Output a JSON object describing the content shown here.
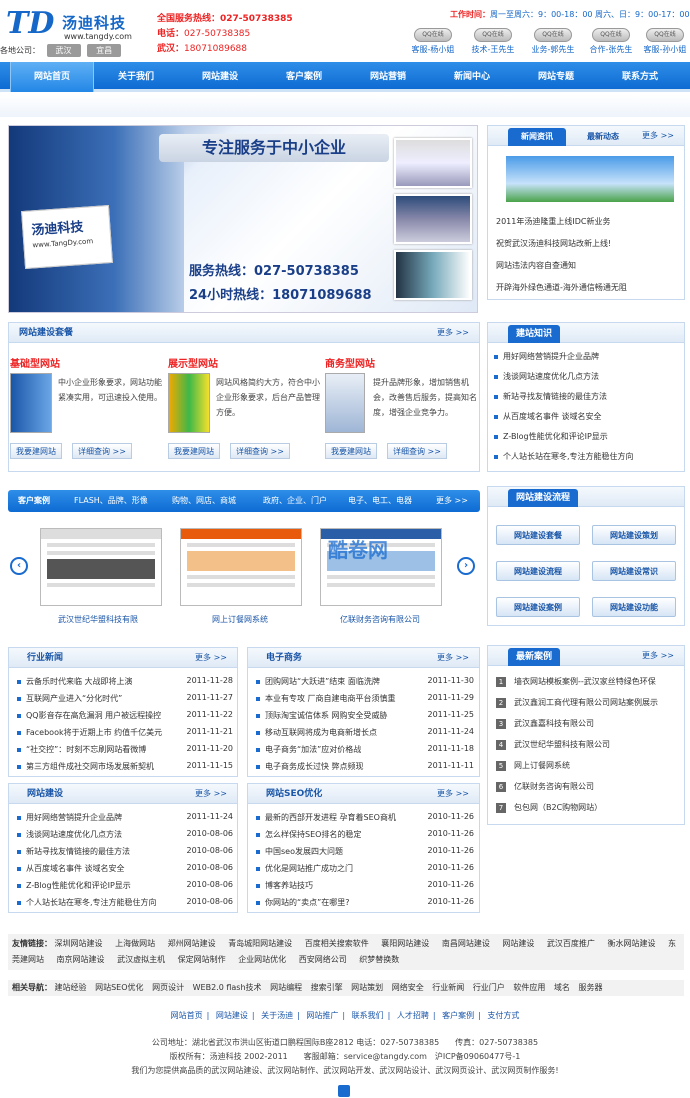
{
  "header": {
    "logo_mark": "TD",
    "logo_cn": "汤迪科技",
    "logo_url": "www.tangdy.com",
    "branch_label": "各地公司：",
    "branches": [
      "武汉",
      "宜昌"
    ],
    "hotline_label": "全国服务热线：",
    "hotline": "027-50738385",
    "phone_label": "电话：",
    "phone": "027-50738385",
    "wuhan_label": "武汉：",
    "wuhan": "18071089688",
    "worktime_label": "工作时间：",
    "worktime": "周一至周六：9：00-18：00 周六、日：9：00-17：00",
    "qq": [
      {
        "icon": "QQ在线",
        "name": "客服-杨小姐"
      },
      {
        "icon": "QQ在线",
        "name": "技术-王先生"
      },
      {
        "icon": "QQ在线",
        "name": "业务-郭先生"
      },
      {
        "icon": "QQ在线",
        "name": "合作-张先生"
      },
      {
        "icon": "QQ在线",
        "name": "客服-孙小姐"
      }
    ]
  },
  "nav": [
    "网站首页",
    "关于我们",
    "网站建设",
    "客户案例",
    "网站营销",
    "新闻中心",
    "网站专题",
    "联系方式"
  ],
  "banner": {
    "slogan": "专注服务于中小企业",
    "card_title": "汤迪科技",
    "card_url": "www.TangDy.com",
    "hot1": "服务热线：027-50738385",
    "hot2": "24小时热线：18071089688"
  },
  "news_box": {
    "tab1": "新闻资讯",
    "tab2": "最新动态",
    "more": "更多 >>",
    "items": [
      "2011年汤迪隆重上线IDC新业务",
      "祝贺武汉汤迪科技网站改新上线!",
      "网站违法内容自查通知",
      "开辟海外绿色通道-海外通信畅通无阻"
    ]
  },
  "plan_box": {
    "title": "网站建设套餐",
    "more": "更多 >>",
    "plans": [
      {
        "title": "基础型网站",
        "desc": "中小企业形象要求，网站功能紧凑实用，可迅速投入使用。",
        "btn1": "我要建网站",
        "btn2": "详细查询 >>"
      },
      {
        "title": "展示型网站",
        "desc": "网站风格简约大方，符合中小企业形象要求，后台产品管理方便。",
        "btn1": "我要建网站",
        "btn2": "详细查询 >>"
      },
      {
        "title": "商务型网站",
        "desc": "提升品牌形象，增加销售机会，改善售后服务，提高知名度，增强企业竞争力。",
        "btn1": "我要建网站",
        "btn2": "详细查询 >>"
      }
    ]
  },
  "knowledge": {
    "title": "建站知识",
    "items": [
      "用好网络营销提升企业品牌",
      "浅谈网站速度优化几点方法",
      "新站寻找友情链接的最佳方法",
      "从百度域名事件 谈域名安全",
      "Z-Blog性能优化和评论IP显示",
      "个人站长站在寒冬,专注方能稳住方向"
    ]
  },
  "cases": {
    "label": "客户案例",
    "cats": [
      "FLASH、品牌、形像",
      "购物、网店、商城",
      "政府、企业、门户",
      "电子、电工、电器"
    ],
    "more": "更多 >>",
    "prev": "‹",
    "next": "›",
    "items": [
      "武汉世纪华盟科技有限",
      "网上订餐网系统",
      "亿联财务咨询有限公司"
    ],
    "watermark": "酷卷网"
  },
  "process": {
    "title": "网站建设流程",
    "buttons": [
      "网站建设套餐",
      "网站建设策划",
      "网站建设流程",
      "网站建设常识",
      "网站建设案例",
      "网站建设功能"
    ]
  },
  "industry": {
    "title": "行业新闻",
    "more": "更多 >>",
    "items": [
      [
        "云备乐时代来临 大战即将上演",
        "2011-11-28"
      ],
      [
        "互联网产业进入“分化时代”",
        "2011-11-27"
      ],
      [
        "QQ影音存在高危漏洞 用户被远程操控",
        "2011-11-22"
      ],
      [
        "Facebook将于近期上市 约值千亿美元",
        "2011-11-21"
      ],
      [
        "“社交控”：时刻不忘刷网站看微博",
        "2011-11-20"
      ],
      [
        "第三方组件成社交网市场发展新契机",
        "2011-11-15"
      ]
    ]
  },
  "ecommerce": {
    "title": "电子商务",
    "more": "更多 >>",
    "items": [
      [
        "团购网站“大跃进”结束 面临洗牌",
        "2011-11-30"
      ],
      [
        "本业有专攻 厂商自建电商平台须慎重",
        "2011-11-29"
      ],
      [
        "顶际淘宝诚信体系 网购安全受威胁",
        "2011-11-25"
      ],
      [
        "移动互联网将成为电商新增长点",
        "2011-11-24"
      ],
      [
        "电子商务“加法”应对价格战",
        "2011-11-18"
      ],
      [
        "电子商务成长过快 弊点频现",
        "2011-11-11"
      ]
    ]
  },
  "latest": {
    "title": "最新案例",
    "more": "更多 >>",
    "items": [
      "墙衣网站模板案例--武汉家丝特绿色环保",
      "武汉鑫润工商代理有限公司网站案例展示",
      "武汉鑫嘉科技有限公司",
      "武汉世纪华盟科技有限公司",
      "网上订餐网系统",
      "亿联财务咨询有限公司",
      "包包网（B2C购物网站）"
    ]
  },
  "build": {
    "title": "网站建设",
    "more": "更多 >>",
    "items": [
      [
        "用好网络营销提升企业品牌",
        "2011-11-24"
      ],
      [
        "浅谈网站速度优化几点方法",
        "2010-08-06"
      ],
      [
        "新站寻找友情链接的最佳方法",
        "2010-08-06"
      ],
      [
        "从百度域名事件 谈域名安全",
        "2010-08-06"
      ],
      [
        "Z-Blog性能优化和评论IP显示",
        "2010-08-06"
      ],
      [
        "个人站长站在寒冬,专注方能稳住方向",
        "2010-08-06"
      ]
    ]
  },
  "seo": {
    "title": "网站SEO优化",
    "more": "更多 >>",
    "items": [
      [
        "最新的西部开发进程 孕育着SEO商机",
        "2010-11-26"
      ],
      [
        "怎么样保持SEO排名的稳定",
        "2010-11-26"
      ],
      [
        "中国seo发展四大问题",
        "2010-11-26"
      ],
      [
        "优化是网站推广成功之门",
        "2010-11-26"
      ],
      [
        "博客养站技巧",
        "2010-11-26"
      ],
      [
        "你网站的“卖点”在哪里?",
        "2010-11-26"
      ]
    ]
  },
  "friends": {
    "label": "友情链接：",
    "links": [
      "深圳网站建设",
      "上海做网站",
      "郑州网站建设",
      "青岛城阳网站建设",
      "百度相关搜索软件",
      "襄阳网站建设",
      "南昌网站建设",
      "网站建设",
      "武汉百度推广",
      "衡水网站建设",
      "东莞建网站",
      "南京网站建设",
      "武汉虚拟主机",
      "保定网站制作",
      "企业网站优化",
      "西安网络公司",
      "织梦替换数"
    ]
  },
  "related": {
    "label": "相关导航：",
    "links": [
      "建站经验",
      "网站SEO优化",
      "网页设计",
      "WEB2.0 flash技术",
      "网站编程",
      "搜索引擎",
      "网站策划",
      "网络安全",
      "行业新闻",
      "行业门户",
      "软件应用",
      "域名",
      "服务器"
    ]
  },
  "footnav": [
    "网站首页",
    "网站建设",
    "关于汤迪",
    "网站推广",
    "联系我们",
    "人才招聘",
    "客户案例",
    "支付方式"
  ],
  "footinfo": [
    "公司地址：湖北省武汉市洪山区街道口鹏程国际B座2812 电话：027-50738385　　传真：027-50738385",
    "版权所有：汤迪科技 2002-2011　　客服邮箱：service@tangdy.com　沪ICP备09060477号-1",
    "我们为您提供高品质的武汉网站建设、武汉网站制作、武汉网站开发、武汉网站设计、武汉网页设计、武汉网页制作服务!"
  ]
}
